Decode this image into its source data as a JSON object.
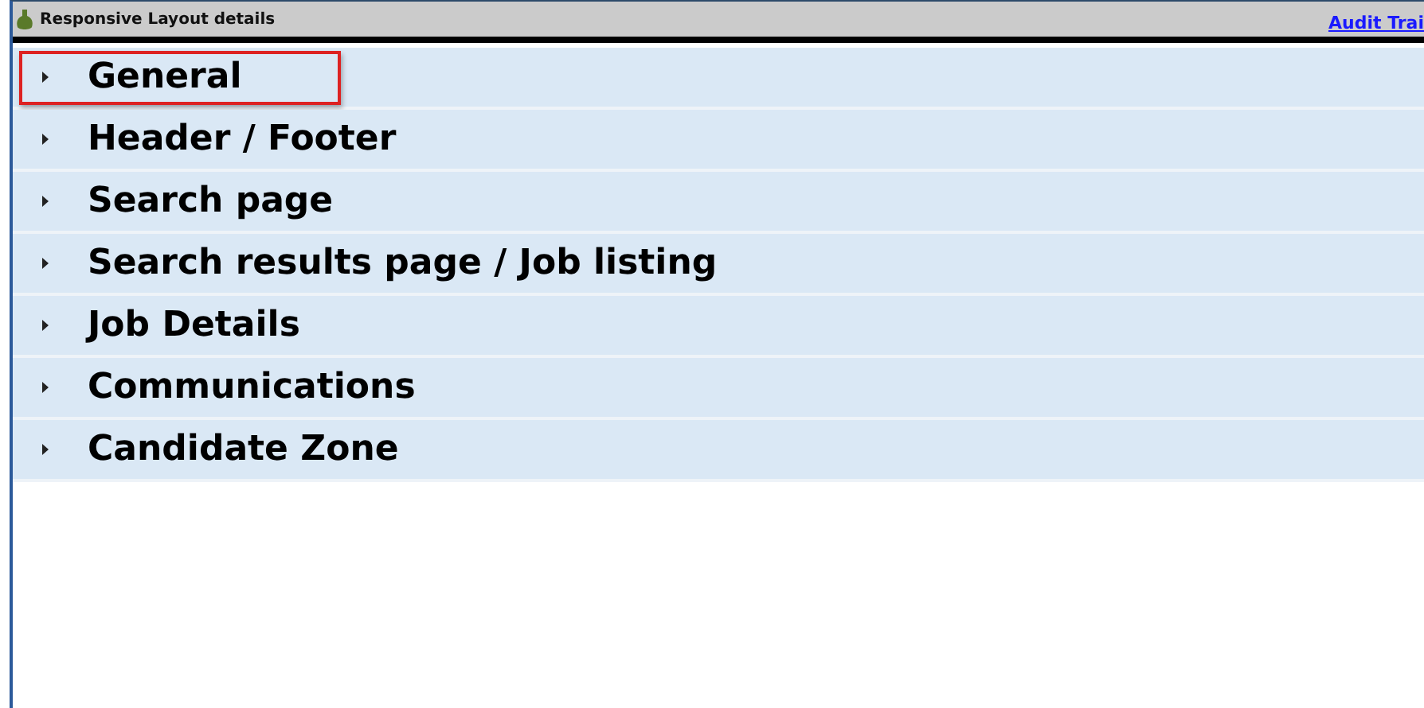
{
  "header": {
    "title": "Responsive Layout details",
    "link": "Audit Trai"
  },
  "sections": [
    {
      "label": "General",
      "expanded": false,
      "highlighted": true
    },
    {
      "label": "Header / Footer",
      "expanded": false,
      "highlighted": false
    },
    {
      "label": "Search page",
      "expanded": false,
      "highlighted": false
    },
    {
      "label": "Search results page / Job listing",
      "expanded": false,
      "highlighted": false
    },
    {
      "label": "Job Details",
      "expanded": false,
      "highlighted": false
    },
    {
      "label": "Communications",
      "expanded": false,
      "highlighted": false
    },
    {
      "label": "Candidate Zone",
      "expanded": false,
      "highlighted": false
    }
  ]
}
